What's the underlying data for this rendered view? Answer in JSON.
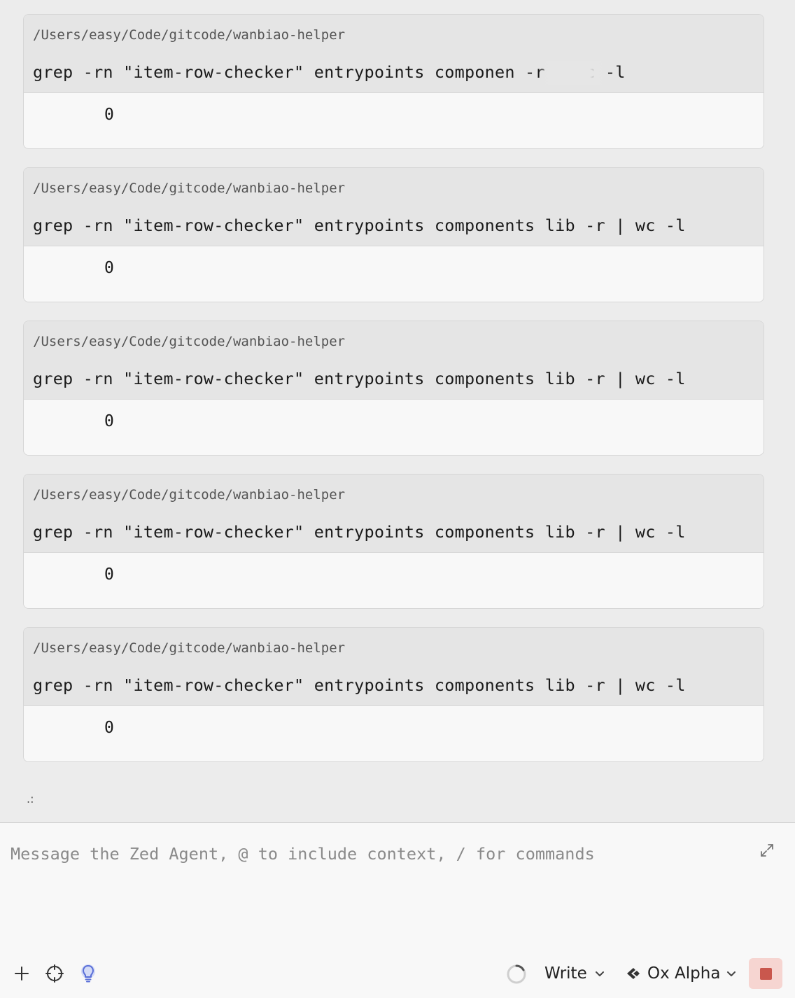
{
  "terminal_blocks": [
    {
      "cwd": "/Users/easy/Code/gitcode/wanbiao-helper",
      "command": "grep -rn \"item-row-checker\" entrypoints componen          -r | wc -l",
      "output": "0"
    },
    {
      "cwd": "/Users/easy/Code/gitcode/wanbiao-helper",
      "command": "grep -rn \"item-row-checker\" entrypoints components lib -r | wc -l",
      "output": "0"
    },
    {
      "cwd": "/Users/easy/Code/gitcode/wanbiao-helper",
      "command": "grep -rn \"item-row-checker\" entrypoints components lib -r | wc -l",
      "output": "0"
    },
    {
      "cwd": "/Users/easy/Code/gitcode/wanbiao-helper",
      "command": "grep -rn \"item-row-checker\" entrypoints components lib -r | wc -l",
      "output": "0"
    },
    {
      "cwd": "/Users/easy/Code/gitcode/wanbiao-helper",
      "command": "grep -rn \"item-row-checker\" entrypoints components lib -r | wc -l",
      "output": "0"
    }
  ],
  "drag_handle": ".:",
  "composer": {
    "placeholder": "Message the Zed Agent, @ to include context, / for commands",
    "value": ""
  },
  "toolbar": {
    "mode_label": "Write",
    "model_label": "Ox Alpha",
    "icons": [
      "plus-icon",
      "crosshair-icon",
      "lightbulb-icon",
      "spinner-icon",
      "chevron-down-icon",
      "model-logo-icon",
      "stop-icon"
    ]
  },
  "colors": {
    "panel_bg": "#ececec",
    "terminal_header": "#e5e5e5",
    "composer_bg": "#f8f8f8",
    "stop_bg": "#f6d5d1",
    "stop_fg": "#c9574d",
    "bulb_accent": "#5a6fd8"
  }
}
